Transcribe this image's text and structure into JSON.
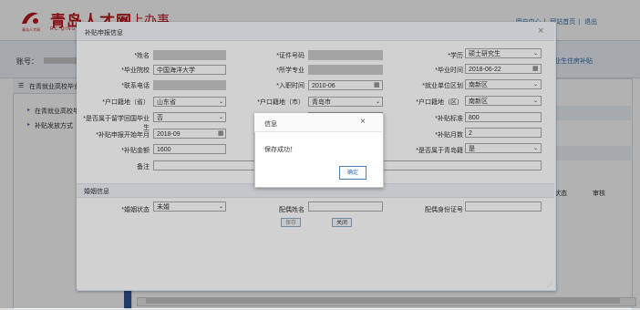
{
  "header": {
    "logo_cn": "青岛人才网",
    "logo_sub": "网上办事",
    "logo_en": "RC.QING",
    "logo_tag": "青岛人才网",
    "links": [
      "用户中心",
      "网站首页",
      "退出"
    ]
  },
  "nav": {
    "account_label": "账号：",
    "right_link": "业生住房补贴"
  },
  "sidebar": {
    "title": "在青就业高校毕业",
    "items": [
      "在青就业高校毕",
      "补贴发放方式"
    ]
  },
  "list": {
    "col_status": "状态",
    "col_audit": "审核"
  },
  "dialog": {
    "title": "补贴申报信息",
    "section2_title": "婚姻信息",
    "labels": {
      "name": "*姓名",
      "id_no": "*证件号码",
      "education": "*学历",
      "school": "*毕业院校",
      "major": "*所学专业",
      "grad_time": "*毕业时间",
      "phone": "*联系电话",
      "entry_time": "*入职时间",
      "work_district": "*就业单位区划",
      "hukou_province": "*户口籍地（省）",
      "hukou_city": "*户口籍地（市）",
      "hukou_district": "*户口籍地（区）",
      "overseas": "*是否属于留学回国毕业生",
      "subsidy_std": "*补贴标准",
      "apply_start": "*补贴申报开始年月",
      "subsidy_months": "*补贴月数",
      "subsidy_amount": "*补贴金额",
      "qingdao_native": "*是否属于青岛籍",
      "remarks": "备注",
      "marital": "*婚姻状态",
      "spouse_name": "配偶姓名",
      "spouse_id": "配偶身份证号"
    },
    "values": {
      "education": "硕士研究生",
      "school": "中国海洋大学",
      "grad_time": "2018-06-22",
      "entry_time": "2010-06",
      "work_district": "南新区",
      "hukou_province": "山东省",
      "hukou_city": "青岛市",
      "hukou_district": "南新区",
      "overseas": "否",
      "subsidy_std": "800",
      "apply_start": "2018-09",
      "subsidy_months": "2",
      "subsidy_amount": "1600",
      "qingdao_native": "是",
      "marital": "未婚"
    },
    "buttons": {
      "save": "保存",
      "close": "关闭"
    }
  },
  "message": {
    "title": "信息",
    "text": "保存成功！",
    "ok": "确定"
  }
}
